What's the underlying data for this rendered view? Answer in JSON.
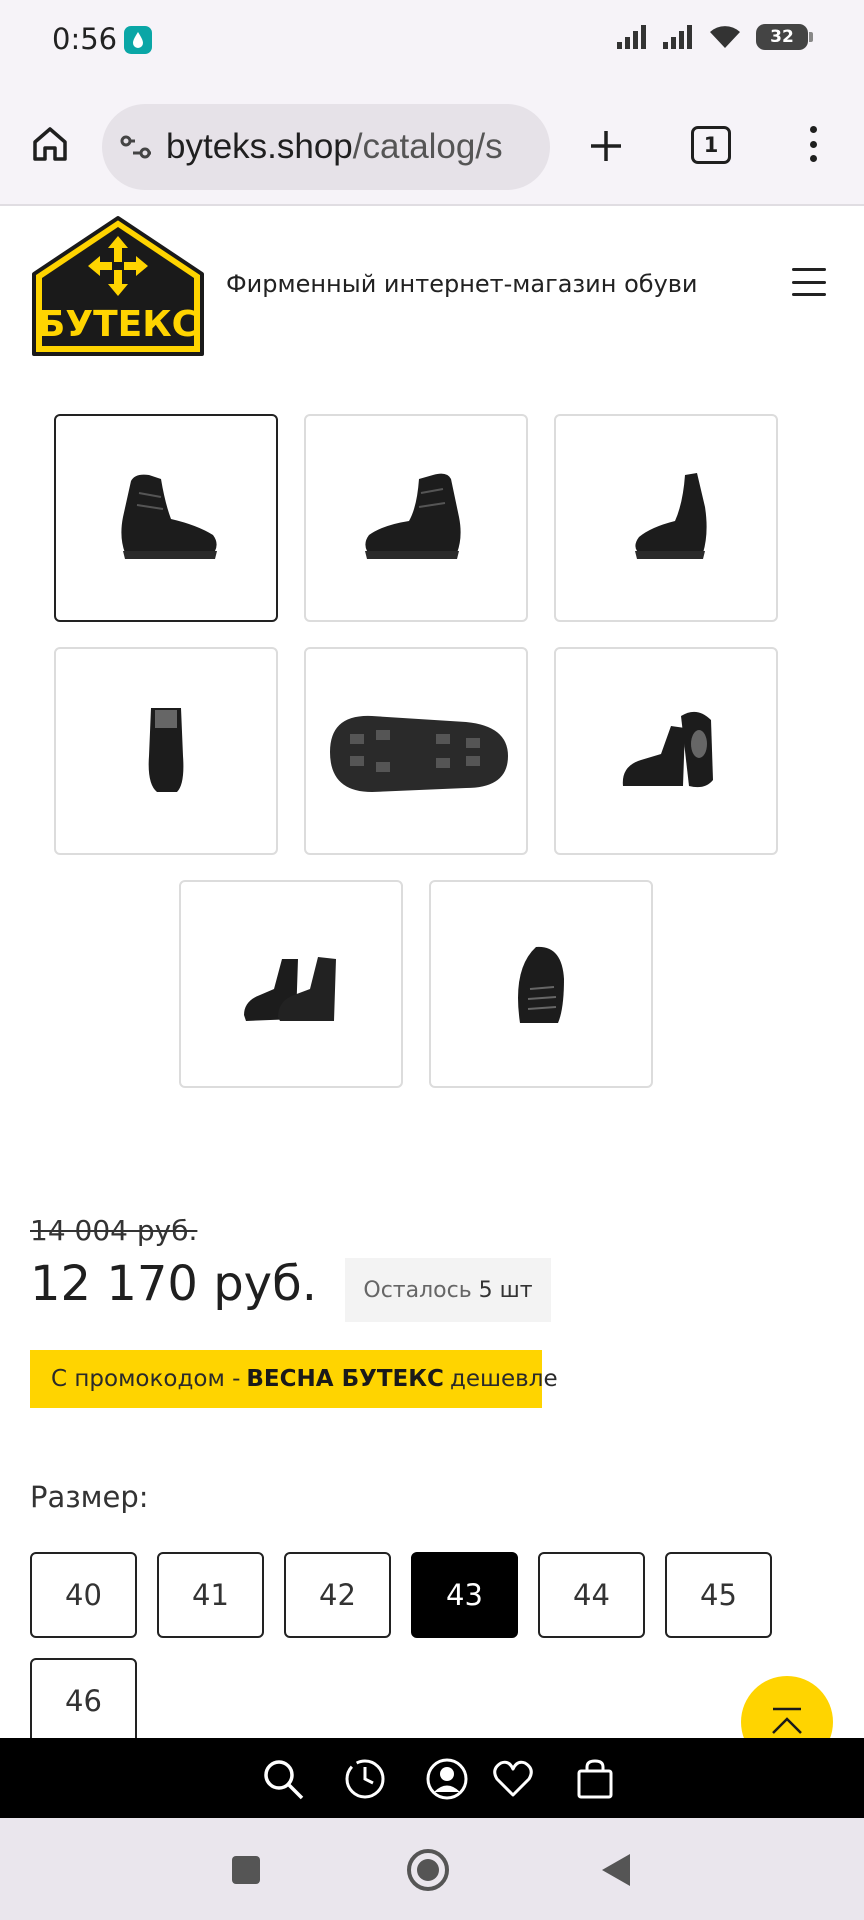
{
  "status": {
    "time": "0:56",
    "battery": "32",
    "app_icon": "water-drop-icon"
  },
  "browser": {
    "url_domain": "byteks.shop",
    "url_path": "/catalog/s",
    "tab_count": "1"
  },
  "site": {
    "logo_text": "БУТЕКС",
    "tagline": "Фирменный интернет-магазин обуви"
  },
  "gallery": {
    "thumbnails": [
      "boot-side-view",
      "boot-side-right",
      "boot-side-left",
      "boot-back-view",
      "boot-sole-view",
      "boot-pair-view",
      "boot-pair-front",
      "boot-toe-view"
    ],
    "active_index": 0
  },
  "product": {
    "old_price": "14 004 руб.",
    "price": "12 170 руб.",
    "stock_label": "Осталось",
    "stock_value": "5 шт",
    "promo_prefix": "С промокодом -",
    "promo_code": "ВЕСНА БУТЕКС",
    "promo_suffix": "дешевле",
    "size_label": "Размер:",
    "sizes": [
      "40",
      "41",
      "42",
      "43",
      "44",
      "45",
      "46"
    ],
    "selected_size": "43"
  },
  "colors": {
    "accent_yellow": "#ffd400",
    "nav_black": "#000000"
  }
}
